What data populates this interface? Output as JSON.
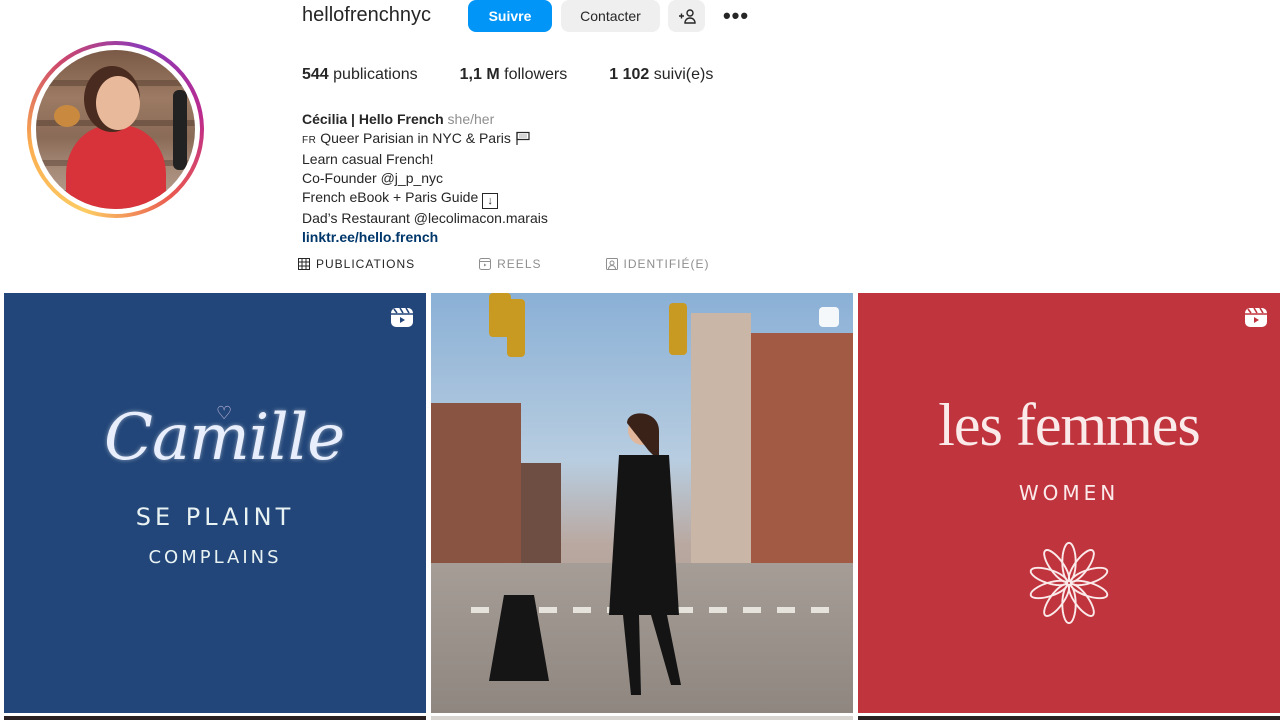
{
  "profile": {
    "username": "hellofrenchnyc",
    "follow_label": "Suivre",
    "contact_label": "Contacter",
    "add_user_label": "+⚐",
    "more_label": "•••",
    "stats": [
      {
        "value": "544",
        "label": "publications"
      },
      {
        "value": "1,1 M",
        "label": "followers"
      },
      {
        "value": "1 102",
        "label": "suivi(e)s"
      }
    ],
    "bio": {
      "name": "Cécilia | Hello French",
      "pronouns": "she/her",
      "lines": [
        {
          "prefix": "FR",
          "text": "Queer Parisian in NYC & Paris",
          "suffix": "🏳️"
        },
        {
          "text": "Learn casual French!"
        },
        {
          "text": "Co-Founder @j_p_nyc"
        },
        {
          "text": "French eBook + Paris Guide",
          "suffix": "↓"
        },
        {
          "text": "Dad’s Restaurant @lecolimacon.marais"
        }
      ],
      "link": "linktr.ee/hello.french"
    }
  },
  "tabs": [
    {
      "label": "PUBLICATIONS",
      "icon": "grid-icon",
      "active": true
    },
    {
      "label": "REELS",
      "icon": "reels-icon",
      "active": false
    },
    {
      "label": "IDENTIFIÉ(E)",
      "icon": "tagged-icon",
      "active": false
    }
  ],
  "posts": [
    {
      "type": "reel",
      "title": "Camille",
      "line1": "SE PLAINT",
      "line2": "COMPLAINS",
      "bg": "#224679"
    },
    {
      "type": "photo",
      "description": "Woman in black coat crossing a New York street",
      "icon": "clip-icon"
    },
    {
      "type": "reel",
      "title": "les femmes",
      "line1": "WOMEN",
      "bg": "#c0343e"
    }
  ],
  "colors": {
    "accent": "#0095f6",
    "text": "#262626",
    "muted": "#8e8e8e",
    "link": "#00376b"
  }
}
